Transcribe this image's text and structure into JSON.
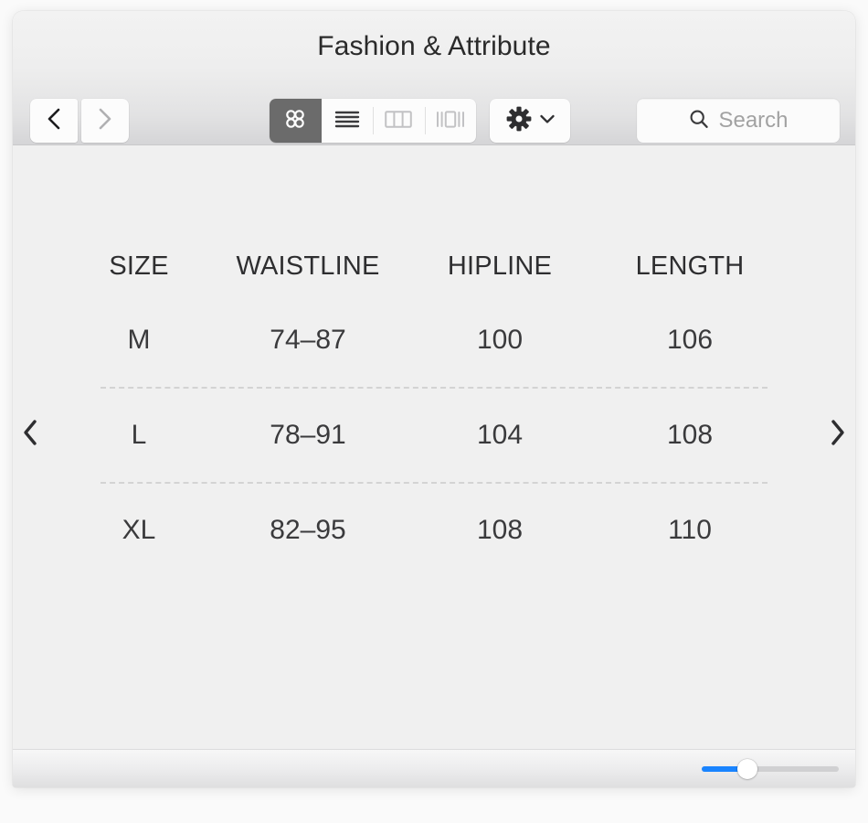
{
  "window": {
    "title": "Fashion & Attribute"
  },
  "toolbar": {
    "back_label": "Back",
    "back_icon": "chevron-left-icon",
    "forward_label": "Forward",
    "forward_icon": "chevron-right-icon",
    "view_modes": [
      {
        "label": "Icon view",
        "icon": "grid-view-icon",
        "selected": true
      },
      {
        "label": "List view",
        "icon": "list-view-icon",
        "selected": false
      },
      {
        "label": "Column view",
        "icon": "column-view-icon",
        "selected": false
      },
      {
        "label": "Gallery view",
        "icon": "gallery-view-icon",
        "selected": false
      }
    ],
    "action_menu": {
      "label": "Action",
      "icon": "gear-icon",
      "chevron_icon": "chevron-down-icon"
    },
    "search": {
      "placeholder": "Search",
      "value": "",
      "icon": "search-icon"
    }
  },
  "content": {
    "prev_arrow": {
      "label": "Previous",
      "icon": "chevron-left-icon"
    },
    "next_arrow": {
      "label": "Next",
      "icon": "chevron-right-icon"
    },
    "table": {
      "headers": [
        "SIZE",
        "WAISTLINE",
        "HIPLINE",
        "LENGTH"
      ],
      "rows": [
        {
          "size": "M",
          "waistline": "74–87",
          "hipline": "100",
          "length": "106"
        },
        {
          "size": "L",
          "waistline": "78–91",
          "hipline": "104",
          "length": "108"
        },
        {
          "size": "XL",
          "waistline": "82–95",
          "hipline": "108",
          "length": "110"
        }
      ]
    }
  },
  "statusbar": {
    "zoom_slider": {
      "label": "Icon size",
      "value_percent": 33
    }
  },
  "colors": {
    "accent": "#1a84ff",
    "selected_segment": "#6b6b6b",
    "content_background": "#f0f0f0",
    "text": "#333335"
  }
}
